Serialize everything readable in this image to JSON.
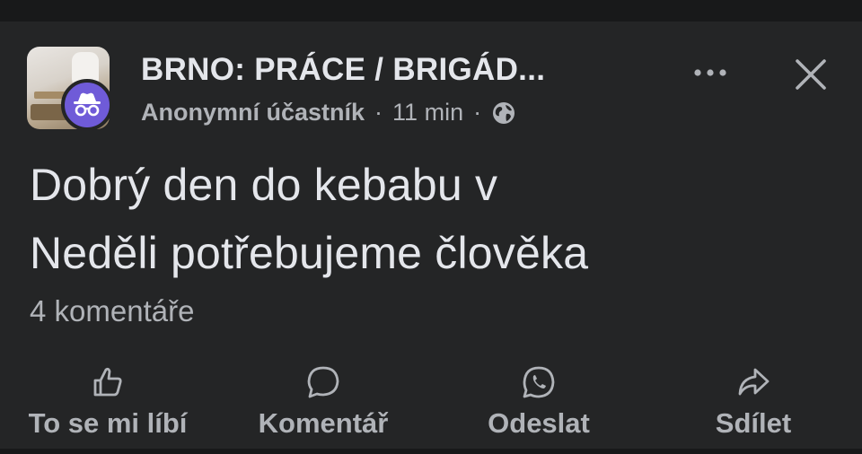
{
  "post": {
    "group_name": "BRNO: PRÁCE / BRIGÁD...",
    "author": "Anonymní účastník",
    "separator": "·",
    "time": "11 min",
    "text_line1": "Dobrý den do kebabu v",
    "text_line2": "Neděli potřebujeme člověka",
    "comments_count": "4 komentáře"
  },
  "icons": {
    "more": "more-horizontal-icon",
    "close": "close-icon",
    "privacy": "globe-icon",
    "anonymous": "incognito-icon"
  },
  "actions": {
    "like": "To se mi líbí",
    "comment": "Komentář",
    "send": "Odeslat",
    "share": "Sdílet"
  },
  "colors": {
    "background": "#242526",
    "text_primary": "#e4e6eb",
    "text_secondary": "#b0b3b8",
    "anonymous_badge": "#6f5bd8"
  }
}
